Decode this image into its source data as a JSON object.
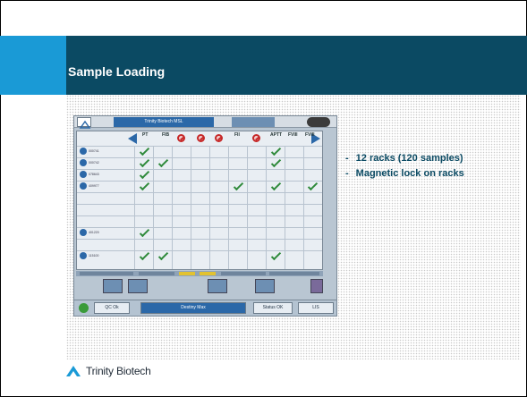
{
  "slide": {
    "title": "Sample Loading",
    "bullets": [
      {
        "marker": "-",
        "text": "12 racks (120 samples)"
      },
      {
        "marker": "-",
        "text": "Magnetic lock on racks"
      }
    ],
    "logo_text": "Trinity Biotech",
    "colors": {
      "title_bar": "#0b4a63",
      "accent": "#1a9ad6",
      "bullet_text": "#0b4a63"
    }
  },
  "screen": {
    "window_title": "Trinity Biotech MSL",
    "columns": [
      "PT",
      "FIB",
      "",
      "",
      "FII",
      "",
      "APTT",
      "FVIII",
      "FVIII"
    ],
    "rows": [
      {
        "label": "000741"
      },
      {
        "label": "000742"
      },
      {
        "label": "078643"
      },
      {
        "label": "409977"
      },
      {
        "label": "401220"
      },
      {
        "label": "115100"
      }
    ],
    "bottom_bar": {
      "qc": "QC Ok",
      "destiny": "Destiny Max",
      "status": "Status OK",
      "lis": "LIS"
    },
    "icons": {
      "logo": "triangle-logo-icon",
      "nav_prev": "arrow-left-icon",
      "nav_next": "arrow-right-icon",
      "blocked": "no-entry-icon",
      "check": "check-icon"
    }
  }
}
